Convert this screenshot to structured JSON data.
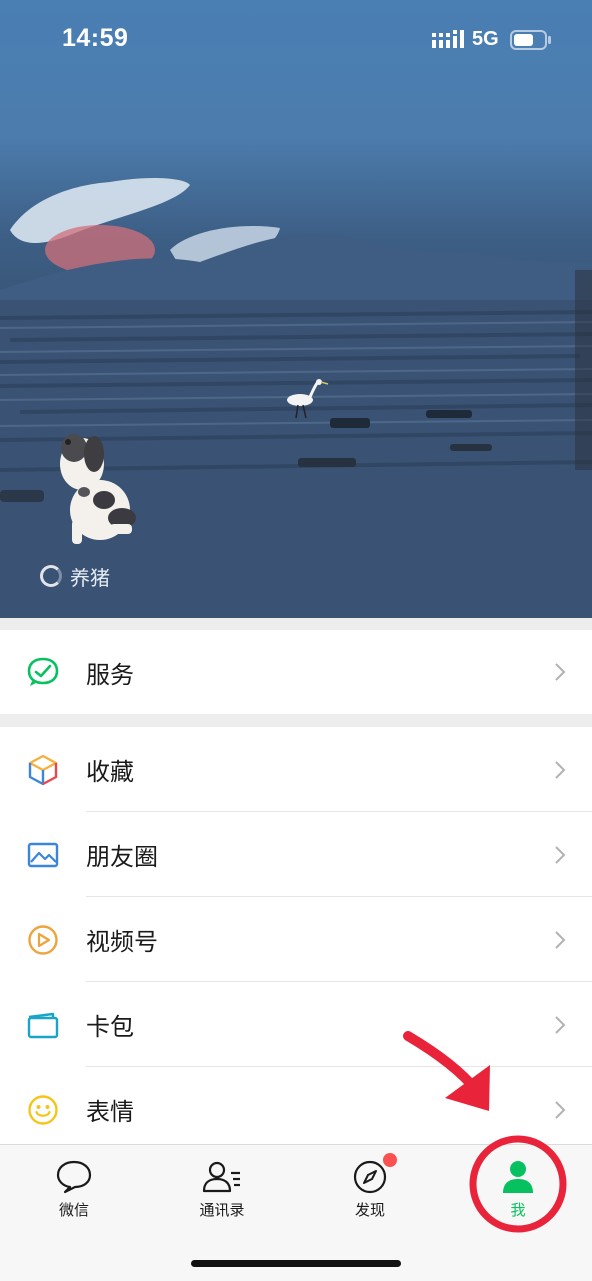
{
  "status_bar": {
    "time": "14:59",
    "network": "5G",
    "signal_icon": "signal-bars-icon",
    "battery_icon": "battery-icon"
  },
  "profile": {
    "status_text": "养猪",
    "status_icon": "status-loading-ring-icon",
    "cover_image": "seascape with egret and dog sticker"
  },
  "services_group": [
    {
      "label": "服务",
      "icon": "service-icon",
      "icon_color": "#07c160"
    }
  ],
  "menu_group": [
    {
      "label": "收藏",
      "icon": "favorites-cube-icon",
      "icon_color": "#f5b041"
    },
    {
      "label": "朋友圈",
      "icon": "moments-photo-icon",
      "icon_color": "#3a86d8"
    },
    {
      "label": "视频号",
      "icon": "channels-play-icon",
      "icon_color": "#f0a23b"
    },
    {
      "label": "卡包",
      "icon": "card-wallet-icon",
      "icon_color": "#1aa5c8"
    },
    {
      "label": "表情",
      "icon": "emoji-smile-icon",
      "icon_color": "#f5c518"
    }
  ],
  "tabbar": {
    "tabs": [
      {
        "label": "微信",
        "icon": "chat-bubble-icon",
        "active": false
      },
      {
        "label": "通讯录",
        "icon": "contacts-icon",
        "active": false
      },
      {
        "label": "发现",
        "icon": "compass-icon",
        "active": false,
        "badge": true
      },
      {
        "label": "我",
        "icon": "person-icon",
        "active": true
      }
    ],
    "active_color": "#07c160",
    "badge_color": "#fa5151"
  },
  "annotation": {
    "arrow_icon": "red-arrow-icon",
    "circle_icon": "red-highlight-circle-icon",
    "color": "#e8233a"
  }
}
